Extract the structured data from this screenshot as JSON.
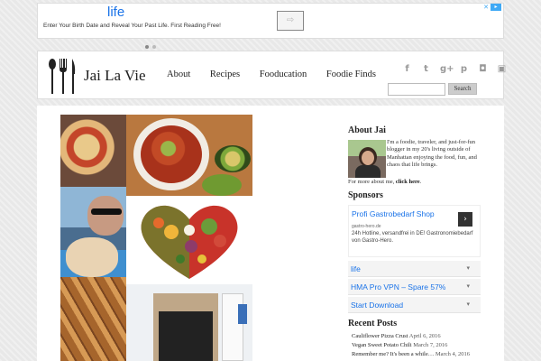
{
  "top_ad": {
    "title": "life",
    "text": "Enter Your Birth Date and Reveal Your Past Life. First Reading Free!",
    "arrow": "⇨",
    "choices_icon": "ad-choices-icon",
    "close": "✕",
    "pager_active": 0,
    "pager_count": 2
  },
  "header": {
    "logo_text": "Jai La Vie",
    "nav": [
      "About",
      "Recipes",
      "Fooducation",
      "Foodie Finds"
    ],
    "social_icons": [
      "facebook-icon",
      "twitter-icon",
      "google-plus-icon",
      "pinterest-icon",
      "instagram-icon",
      "flickr-icon"
    ],
    "social_glyphs": [
      "f",
      "t",
      "g+",
      "p",
      "◘",
      "▣"
    ],
    "search_placeholder": "",
    "search_button": "Search"
  },
  "sidebar": {
    "about_heading": "About Jai",
    "about_text": "I'm a foodie, traveler, and just-for-fun blogger in my 20's living outside of Manhattan enjoying the food, fun, and chaos that life brings.",
    "about_more_prefix": "For more about me, ",
    "about_more_link": "click here",
    "about_more_suffix": ".",
    "sponsors_heading": "Sponsors",
    "sponsor_ad": {
      "title": "Profi Gastrobedarf Shop",
      "url": "gastro-hero.de",
      "desc": "24h Hotline, versandfrei in DE! Gastronomiebedarf von Gastro-Hero.",
      "go": "›"
    },
    "links": [
      {
        "label": "life",
        "chev": "▾"
      },
      {
        "label": "HMA Pro VPN – Spare 57%",
        "chev": "▾"
      },
      {
        "label": "Start Download",
        "chev": "▾"
      }
    ],
    "recent_heading": "Recent Posts",
    "recent_posts": [
      {
        "title": "Cauliflower Pizza Crust",
        "date": "April 6, 2016"
      },
      {
        "title": "Vegan Sweet Potato Chili",
        "date": "March 7, 2016"
      },
      {
        "title": "Remember me? It's been a while…",
        "date": "March 4, 2016"
      }
    ]
  },
  "theme": {
    "link_blue": "#1a73e8",
    "page_bg": "#e8e8e8"
  }
}
